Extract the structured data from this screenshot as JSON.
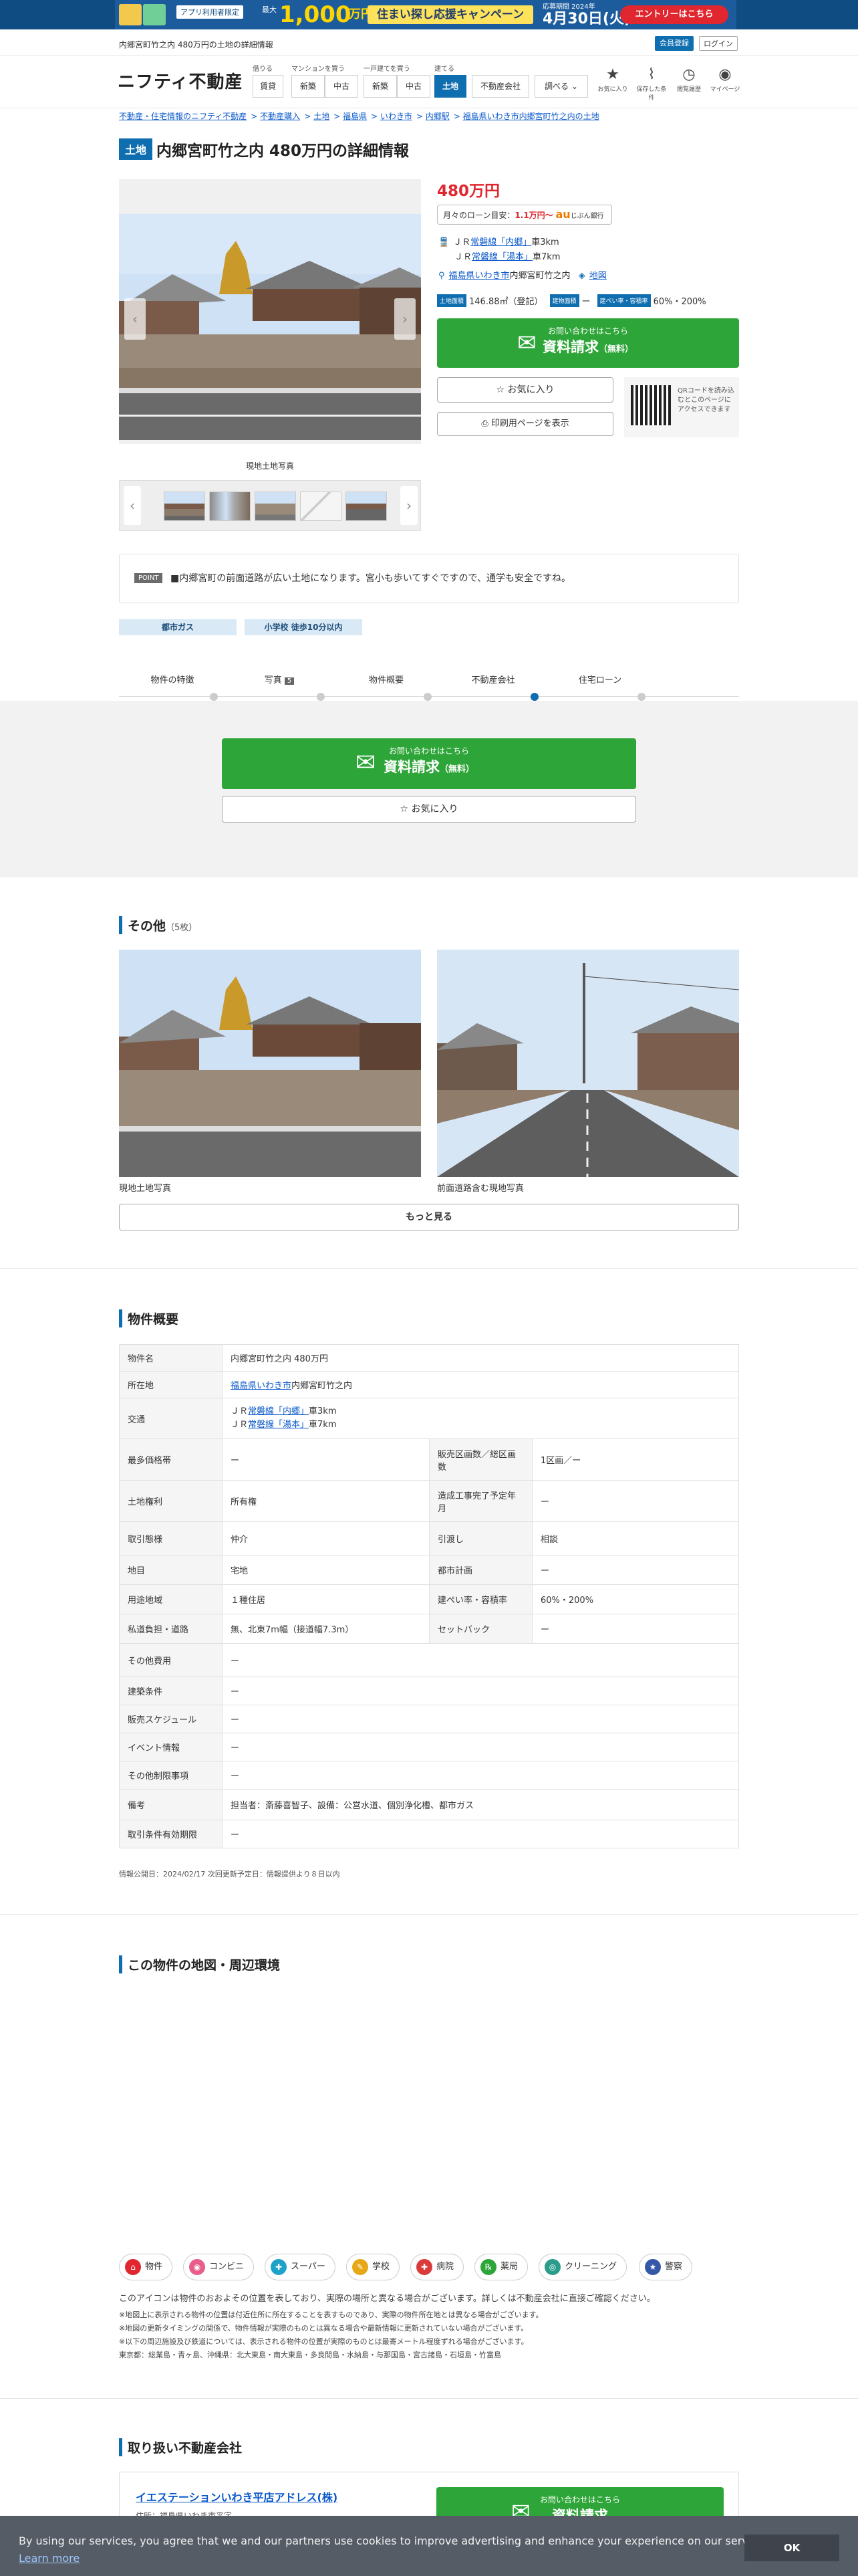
{
  "banner": {
    "app_tag": "アプリ利用者限定",
    "max_label": "最大",
    "amount": "1,000",
    "unit": "万円",
    "campaign": "住まい探し応援キャンペーン",
    "deadline_label": "応募期間 2024年",
    "deadline": "4月30日(火)",
    "entry": "エントリーはこちら"
  },
  "topbar": {
    "page_heading": "内郷宮町竹之内 480万円の土地の詳細情報",
    "register": "会員登録",
    "login": "ログイン"
  },
  "header": {
    "logo": "ニフティ不動産",
    "groups": [
      {
        "label": "借りる"
      },
      {
        "label": "マンションを買う"
      },
      {
        "label": "一戸建てを買う"
      },
      {
        "label": "建てる"
      }
    ],
    "nav": [
      "賃貸",
      "新築",
      "中古",
      "新築",
      "中古",
      "土地",
      "不動産会社",
      "調べる"
    ],
    "icons": [
      {
        "label": "お気に入り",
        "icon": "star-icon"
      },
      {
        "label": "保存した条件",
        "icon": "clip-icon"
      },
      {
        "label": "閲覧履歴",
        "icon": "history-icon"
      },
      {
        "label": "マイページ",
        "icon": "user-icon"
      }
    ]
  },
  "breadcrumb": [
    "不動産・住宅情報のニフティ不動産",
    "不動産購入",
    "土地",
    "福島県",
    "いわき市",
    "内郷駅",
    "福島県いわき市内郷宮町竹之内の土地"
  ],
  "property": {
    "type_tag": "土地",
    "title": "内郷宮町竹之内 480万円の詳細情報",
    "main_caption": "現地土地写真",
    "price": "480万円",
    "loan_label": "月々のローン目安：",
    "loan_value": "1.1万円〜",
    "loan_bank": "じぶん銀行",
    "loan_au": "au",
    "access": [
      {
        "prefix": "ＪＲ",
        "line": "常磐線「内郷」",
        "suffix": "車3km"
      },
      {
        "prefix": "ＪＲ",
        "line": "常磐線「湯本」",
        "suffix": "車7km"
      }
    ],
    "address_link": "福島県いわき市",
    "address_rest": "内郷宮町竹之内",
    "map_link": "地図",
    "land_area_tag": "土地面積",
    "land_area": "146.88㎡（登記）",
    "building_area_tag": "建物面積",
    "building_area": "ー",
    "ratio_tag": "建ぺい率・容積率",
    "ratio": "60%・200%",
    "cta_small": "お問い合わせはこちら",
    "cta_large": "資料請求",
    "cta_free": "（無料）",
    "favorite": "お気に入り",
    "print": "印刷用ページを表示",
    "qr_text": "QRコードを読み込むとこのページにアクセスできます",
    "point_tag": "POINT",
    "point_text": "■内郷宮町の前面道路が広い土地になります。宮小も歩いてすぐですので、通学も安全ですね。",
    "badges": [
      "都市ガス",
      "小学校 徒歩10分以内"
    ]
  },
  "tabs": [
    {
      "label": "物件の特徴"
    },
    {
      "label": "写真",
      "count": "5"
    },
    {
      "label": "物件概要"
    },
    {
      "label": "不動産会社"
    },
    {
      "label": "住宅ローン"
    }
  ],
  "band": {
    "cta_small": "お問い合わせはこちら",
    "cta_large": "資料請求",
    "cta_free": "（無料）",
    "favorite": "お気に入り"
  },
  "other": {
    "title": "その他",
    "count": "（5枚）",
    "captions": [
      "現地土地写真",
      "前面道路含む現地写真"
    ],
    "more": "もっと見る"
  },
  "summary": {
    "title": "物件概要",
    "rows": [
      {
        "k": "物件名",
        "v": "内郷宮町竹之内 480万円"
      },
      {
        "k": "所在地",
        "link": "福島県いわき市",
        "rest": "内郷宮町竹之内"
      },
      {
        "k": "交通",
        "lines": [
          [
            "ＪＲ",
            "常磐線「内郷」",
            "車3km"
          ],
          [
            "ＪＲ",
            "常磐線「湯本」",
            "車7km"
          ]
        ]
      },
      {
        "k": "最多価格帯",
        "v": "ー",
        "k2": "販売区画数／総区画数",
        "v2": "1区画／ー"
      },
      {
        "k": "土地権利",
        "v": "所有権",
        "k2": "造成工事完了予定年月",
        "v2": "ー"
      },
      {
        "k": "取引態様",
        "v": "仲介",
        "k2": "引渡し",
        "v2": "相談"
      },
      {
        "k": "地目",
        "v": "宅地",
        "k2": "都市計画",
        "v2": "ー"
      },
      {
        "k": "用途地域",
        "v": "１種住居",
        "k2": "建ぺい率・容積率",
        "v2": "60%・200%"
      },
      {
        "k": "私道負担・道路",
        "v": "無、北東7m幅（接道幅7.3m）",
        "k2": "セットバック",
        "v2": "ー"
      },
      {
        "k": "その他費用",
        "v": "ー"
      },
      {
        "k": "建築条件",
        "v": "ー"
      },
      {
        "k": "販売スケジュール",
        "v": "ー"
      },
      {
        "k": "イベント情報",
        "v": "ー"
      },
      {
        "k": "その他制限事項",
        "v": "ー"
      },
      {
        "k": "備考",
        "v": "担当者：斎藤喜智子、設備：公営水道、個別浄化槽、都市ガス"
      },
      {
        "k": "取引条件有効期限",
        "v": "ー"
      }
    ],
    "footnote": "情報公開日：2024/02/17 次回更新予定日：情報提供より８日以内"
  },
  "map": {
    "title": "この物件の地図・周辺環境",
    "icons": [
      {
        "label": "物件",
        "color": "#e0262f",
        "glyph": "⌂"
      },
      {
        "label": "コンビニ",
        "color": "#e85d8a",
        "glyph": "◉"
      },
      {
        "label": "スーパー",
        "color": "#1fa2c9",
        "glyph": "✚"
      },
      {
        "label": "学校",
        "color": "#e6a817",
        "glyph": "✎"
      },
      {
        "label": "病院",
        "color": "#d93b3b",
        "glyph": "✚"
      },
      {
        "label": "薬局",
        "color": "#2ea538",
        "glyph": "℞"
      },
      {
        "label": "クリーニング",
        "color": "#2b9c8c",
        "glyph": "◎"
      },
      {
        "label": "警察",
        "color": "#3557a8",
        "glyph": "★"
      }
    ],
    "notes": [
      "このアイコンは物件のおおよその位置を表しており、実際の場所と異なる場合がございます。詳しくは不動産会社に直接ご確認ください。",
      "※地図上に表示される物件の位置は付近住所に所在することを表すものであり、実際の物件所在地とは異なる場合がございます。",
      "※地図の更新タイミングの関係で、物件情報が実際のものとは異なる場合や最新情報に更新されていない場合がございます。",
      "※以下の周辺施設及び鉄道については、表示される物件の位置が実際のものとは最寄メートル程度ずれる場合がございます。",
      "東京都：総業島・青ヶ島、沖縄県：北大東島・南大東島・多良間島・水納島・与那国島・宮古諸島・石垣島・竹富島"
    ]
  },
  "agency": {
    "title": "取り扱い不動産会社",
    "name": "イエステーションいわき平店アドレス(株)",
    "sub": "住所：福島県いわき市平字",
    "cta_small": "お問い合わせはこちら",
    "cta_large": "資料請求"
  },
  "cookie": {
    "text": "By using our services, you agree that we and our partners use cookies to improve advertising and enhance your experience on our services.",
    "learn": "Learn more",
    "ok": "OK"
  },
  "colors": {
    "accent": "#0f6eb0",
    "cta": "#2ea538",
    "price": "#e0262f"
  }
}
